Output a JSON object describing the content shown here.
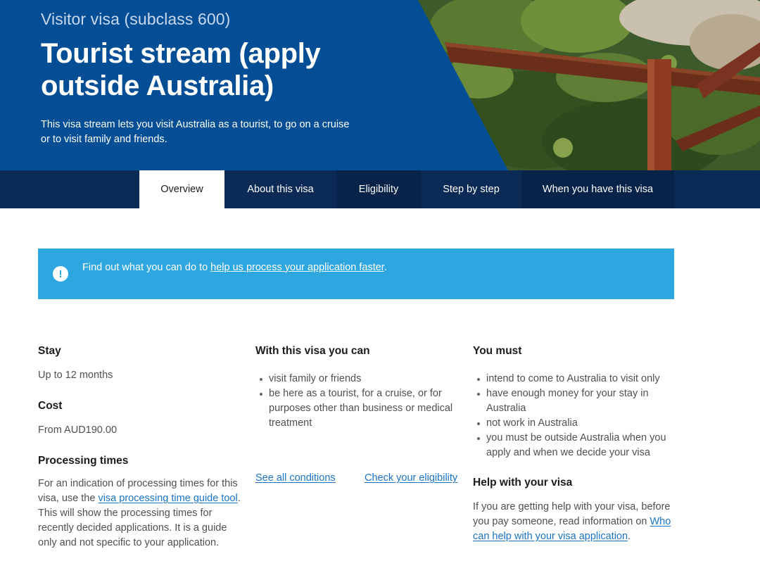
{
  "hero": {
    "subtitle": "Visitor visa (subclass 600)",
    "title": "Tourist stream (apply outside Australia)",
    "description": "This visa stream lets you visit Australia as a tourist, to go on a cruise or to visit family and friends."
  },
  "tabs": [
    {
      "label": "Overview",
      "active": true
    },
    {
      "label": "About this visa",
      "active": false
    },
    {
      "label": "Eligibility",
      "active": false
    },
    {
      "label": "Step by step",
      "active": false
    },
    {
      "label": "When you have this visa",
      "active": false
    }
  ],
  "alert": {
    "icon": "exclamation-icon",
    "text_before": "Find out what you can do to ",
    "link": "help us process your application faster",
    "text_after": "."
  },
  "stay": {
    "heading": "Stay",
    "value": "Up to 12 months"
  },
  "cost": {
    "heading": "Cost",
    "value": "From AUD190.00"
  },
  "processing": {
    "heading": "Processing times",
    "text_before": "For an indication of processing times for this visa, use the ",
    "link": "visa processing time guide tool",
    "text_after": ". This will show the processing times for recently decided applications. It is a guide only and not specific to your application."
  },
  "can": {
    "heading": "With this visa you can",
    "items": [
      "visit family or friends",
      "be here as a tourist, for a cruise, or for purposes other than business or medical treatment"
    ],
    "link_conditions": "See all conditions",
    "link_eligibility": "Check your eligibility"
  },
  "must": {
    "heading": "You must",
    "items": [
      "intend to come to Australia to visit only",
      "have enough money for your stay in Australia",
      "not work in Australia",
      "you must be outside Australia when you apply and when we decide your visa"
    ]
  },
  "help": {
    "heading": "Help with your visa",
    "text_before": "If you are getting help with your visa, before you pay someone, read information on ",
    "link": "Who can help with your visa application",
    "text_after": "."
  },
  "colors": {
    "hero_blue": "#044e96",
    "tab_navy": "#0b2a56",
    "alert_blue": "#2ea6df",
    "link_blue": "#1a73c6"
  }
}
